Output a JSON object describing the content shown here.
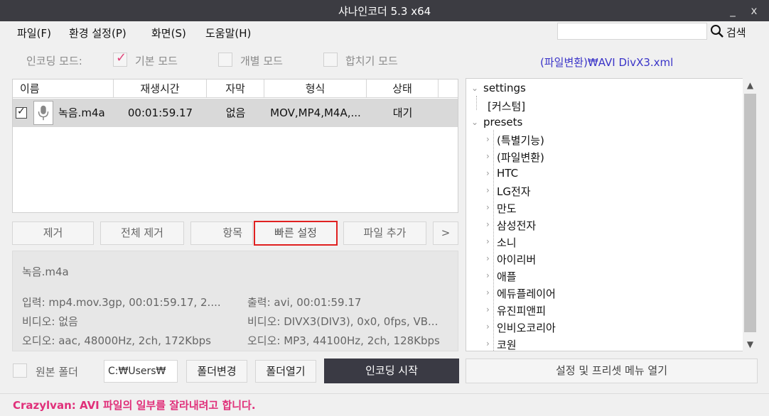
{
  "window": {
    "title": "샤나인코더  5.3  x64",
    "min_glyph": "_",
    "close_glyph": "x"
  },
  "menu": [
    "파일(F)",
    "환경 설정(P)",
    "화면(S)",
    "도움말(H)"
  ],
  "search": {
    "value": "",
    "label": "검색"
  },
  "mode": {
    "label": "인코딩 모드:",
    "basic": {
      "label": "기본 모드",
      "checked": true
    },
    "individual": {
      "label": "개별 모드",
      "checked": false
    },
    "merge": {
      "label": "합치기 모드",
      "checked": false
    }
  },
  "preset_path": "(파일변환)₩AVI DivX3.xml",
  "file_table": {
    "columns": [
      "이름",
      "재생시간",
      "자막",
      "형식",
      "상태"
    ],
    "rows": [
      {
        "name": "녹음.m4a",
        "duration": "00:01:59.17",
        "subtitle": "없음",
        "format": "MOV,MP4,M4A,...",
        "status": "대기",
        "checked": true
      }
    ]
  },
  "buttons": {
    "remove": "제거",
    "remove_all": "전체 제거",
    "items": "항목",
    "quick_settings": "빠른 설정",
    "add_file": "파일 추가",
    "more": ">"
  },
  "info": {
    "filename": "녹음.m4a",
    "input": "입력: mp4.mov.3gp, 00:01:59.17, 2....",
    "input_video": "비디오: 없음",
    "input_audio": "오디오: aac, 48000Hz, 2ch, 172Kbps",
    "output": "출력: avi, 00:01:59.17",
    "output_video": "비디오: DIVX3(DIV3), 0x0, 0fps, VB...",
    "output_audio": "오디오: MP3, 44100Hz, 2ch, 128Kbps"
  },
  "tree": {
    "settings": {
      "label": "settings",
      "children": [
        "[커스텀]"
      ]
    },
    "presets": {
      "label": "presets",
      "children": [
        "(특별기능)",
        "(파일변환)",
        "HTC",
        "LG전자",
        "만도",
        "삼성전자",
        "소니",
        "아이리버",
        "애플",
        "에듀플레이어",
        "유진피앤피",
        "인비오코리아",
        "코원"
      ]
    },
    "scroll_position": 0
  },
  "bottom": {
    "original_folder": {
      "label": "원본 폴더",
      "checked": false
    },
    "folder_path": "C:₩Users₩",
    "change_folder": "폴더변경",
    "open_folder": "폴더열기",
    "start_encoding": "인코딩 시작",
    "open_settings_menu": "설정 및 프리셋 메뉴 열기"
  },
  "status": "Crazylvan: AVI 파일의 일부를 잘라내려고 합니다.",
  "colors": {
    "accent_pink": "#e0307a",
    "preset_blue": "#3a34c8",
    "dark_button": "#3a3a44",
    "highlight_red": "#e02020"
  }
}
